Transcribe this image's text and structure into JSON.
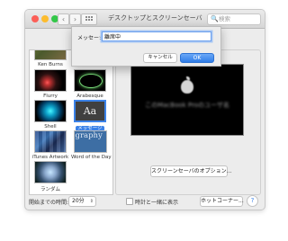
{
  "window": {
    "title": "デスクトップとスクリーンセーバ",
    "nav": {
      "back": "‹",
      "forward": "›"
    },
    "search_icon": "🔍",
    "search_placeholder": "検索"
  },
  "savers": [
    {
      "label": "Ken Burns"
    },
    {
      "label": "Flurry"
    },
    {
      "label": "Arabesque"
    },
    {
      "label": "Shell"
    },
    {
      "label": "メッセージ",
      "thumb_text": "Aa",
      "selected": true
    },
    {
      "label": "iTunes Artwork"
    },
    {
      "label": "Word of the Day",
      "thumb_text": "graphy"
    },
    {
      "label": "ランダム"
    }
  ],
  "preview": {
    "message": "このMacBook Proのユーザ名"
  },
  "options_button": "スクリーンセーバのオプション...",
  "bottom": {
    "start_label": "開始までの時間:",
    "start_value": "20分",
    "show_clock_label": "時計と一緒に表示",
    "hot_corners_button": "ホットコーナー...",
    "help": "?"
  },
  "sheet": {
    "label": "メッセージ:",
    "input_value": "離席中",
    "cancel": "キャンセル",
    "ok": "OK"
  },
  "colors": {
    "accent": "#3b82e8",
    "window_bg": "#ececec",
    "close": "#fc5f57",
    "minimize": "#fdbc2e",
    "maximize": "#33c748"
  }
}
